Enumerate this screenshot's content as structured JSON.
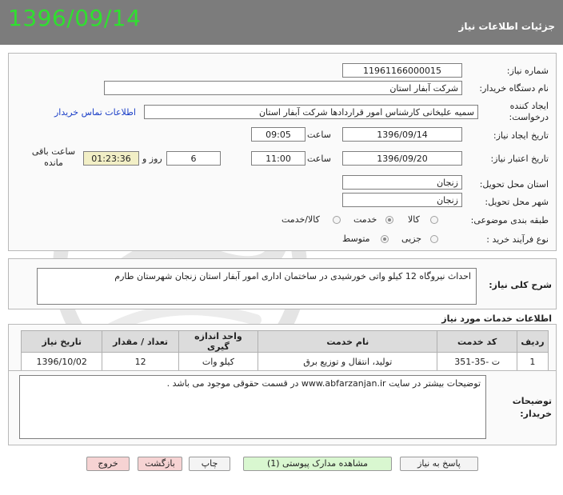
{
  "header": {
    "date": "1396/09/14",
    "title": "جزئیات اطلاعات نیاز"
  },
  "form": {
    "need_number": {
      "label": "شماره نیاز:",
      "value": "1196116600001​5"
    },
    "buyer_org": {
      "label": "نام دستگاه خریدار:",
      "value": "شرکت آبفار استان"
    },
    "requester": {
      "label": "ایجاد کننده درخواست:",
      "value": "سمیه علیخانی کارشناس امور قراردادها  شرکت آبفار استان"
    },
    "buyer_contact_link": "اطلاعات تماس خریدار",
    "created_date": {
      "label": "تاریخ ایجاد نیاز:",
      "date": "1396/09/14",
      "time_label": "ساعت",
      "time": "09:05"
    },
    "validity_date": {
      "label": "تاریخ اعتبار نیاز:",
      "date": "1396/09/20",
      "time_label": "ساعت",
      "time": "11:00",
      "days": "6",
      "days_label": "روز و",
      "remaining": "01:23:36",
      "remaining_label": "ساعت باقی مانده"
    },
    "delivery_province": {
      "label": "استان محل تحویل:",
      "value": "زنجان"
    },
    "delivery_city": {
      "label": "شهر محل تحویل:",
      "value": "زنجان"
    },
    "category": {
      "label": "طبقه بندی موضوعی:",
      "options": [
        "کالا",
        "خدمت",
        "کالا/خدمت"
      ],
      "selected": "خدمت"
    },
    "purchase_type": {
      "label": "نوع فرآیند خرید :",
      "options": [
        "جزیی",
        "متوسط"
      ],
      "selected": "متوسط"
    }
  },
  "description": {
    "label": "شرح کلی نیاز:",
    "text": "احداث نیروگاه 12 کیلو واتی خورشیدی در ساختمان اداری امور آبفار استان زنجان شهرستان طارم"
  },
  "services": {
    "title": "اطلاعات خدمات مورد نیاز",
    "columns": [
      "ردیف",
      "کد خدمت",
      "نام خدمت",
      "واحد اندازه گیری",
      "تعداد / مقدار",
      "تاریخ نیاز"
    ],
    "rows": [
      [
        "1",
        "ت -35-351",
        "تولید، انتقال و توزیع برق",
        "کیلو وات",
        "12",
        "1396/10/02"
      ]
    ]
  },
  "buyer_notes": {
    "label": "توضیحات خریدار:",
    "text": "توضیحات بیشتر در سایت www.abfarzanjan.ir در قسمت حقوقی موجود می باشد ."
  },
  "buttons": {
    "reply": "پاسخ به نیاز",
    "view_docs": "مشاهده مدارک پیوستی (1)",
    "print": "چاپ",
    "back": "بازگشت",
    "exit": "خروج"
  },
  "colors": {
    "header_bg": "#7c7c7c",
    "date_green": "#2fe02f",
    "docs_button_bg": "#d9f7d0",
    "back_button_bg": "#f6d3d3",
    "exit_button_bg": "#f6d3d3"
  }
}
